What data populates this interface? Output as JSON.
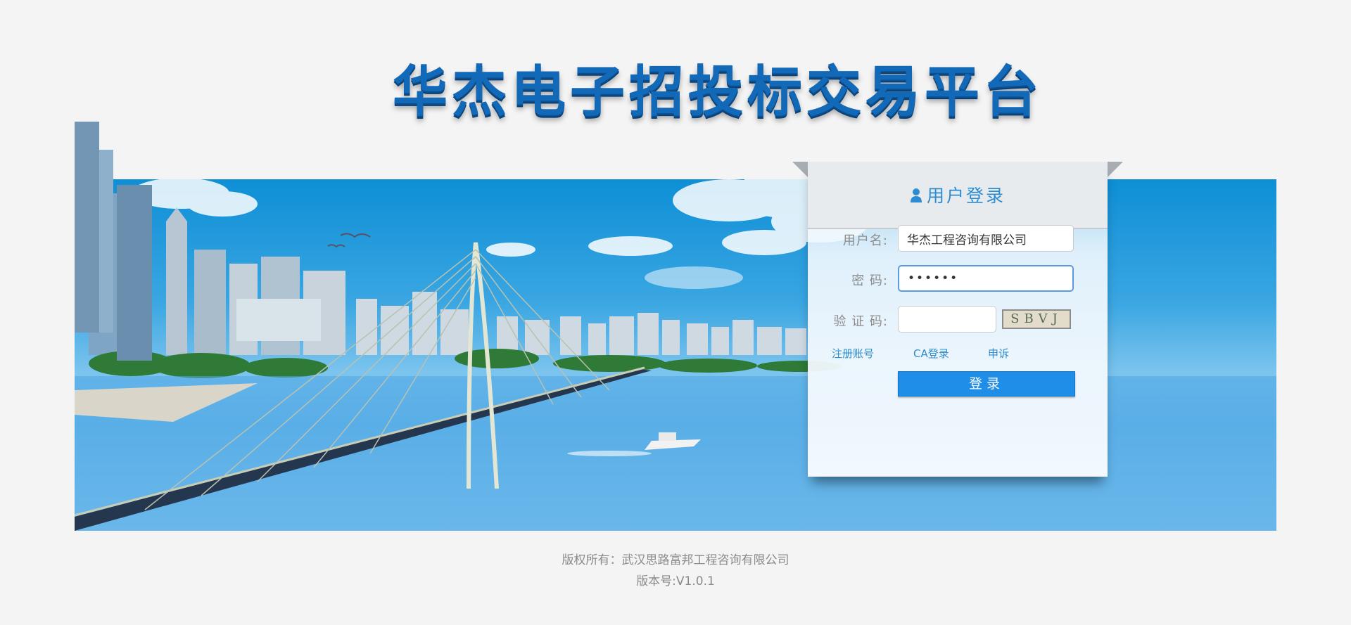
{
  "header": {
    "title": "华杰电子招投标交易平台"
  },
  "login": {
    "title": "用户登录",
    "username_label": "用户名:",
    "username_value": "华杰工程咨询有限公司",
    "password_label": "密 码:",
    "password_value": "••••••",
    "captcha_label": "验 证 码:",
    "captcha_value": "",
    "captcha_text": "SBVJ",
    "links": {
      "register": "注册账号",
      "ca_login": "CA登录",
      "appeal": "申诉"
    },
    "submit_label": "登录"
  },
  "footer": {
    "copyright": "版权所有：武汉思路富邦工程咨询有限公司",
    "version": "版本号:V1.0.1"
  },
  "colors": {
    "brand_blue": "#1269b8",
    "accent": "#2d8bd2",
    "button": "#1f8ee8"
  },
  "icons": {
    "user": "user-icon"
  }
}
